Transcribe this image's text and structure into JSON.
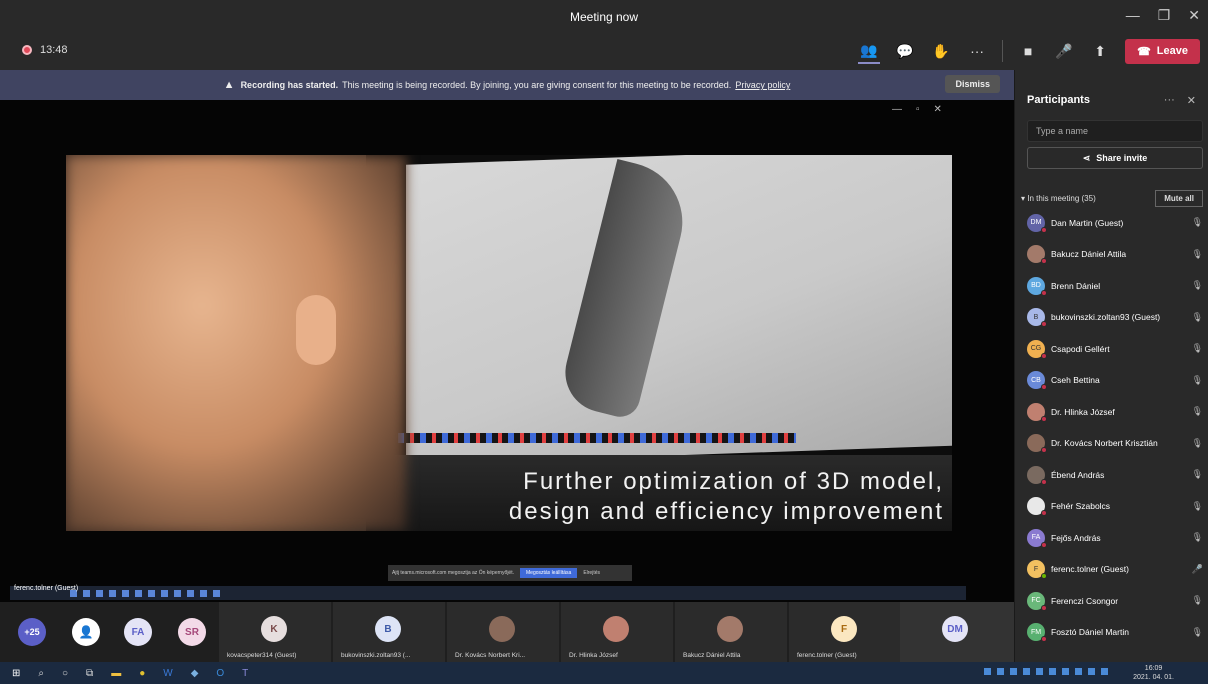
{
  "window": {
    "title": "Meeting now"
  },
  "meeting": {
    "timer": "13:48",
    "leave_label": "Leave",
    "tools": [
      "people-icon",
      "chat-icon",
      "reactions-icon",
      "more-icon",
      "camera-off-icon",
      "mic-off-icon",
      "share-icon"
    ]
  },
  "banner": {
    "bold": "Recording has started.",
    "text": "This meeting is being recorded. By joining, you are giving consent for this meeting to be recorded.",
    "link": "Privacy policy",
    "dismiss": "Dismiss"
  },
  "stage": {
    "caption_line1": "Further optimization of 3D model,",
    "caption_line2": "design and efficiency improvement",
    "presenter": "ferenc.tolner (Guest)",
    "notice_text": "Ajtj teams.microsoft.com megosztja az Ön képernyőjét.",
    "notice_btn": "Megosztás leállítása",
    "notice_hide": "Elrejtés"
  },
  "participants": {
    "title": "Participants",
    "search_placeholder": "Type a name",
    "share_invite": "Share invite",
    "in_meeting": "In this meeting (35)",
    "mute_all": "Mute all",
    "list": [
      {
        "initials": "DM",
        "name": "Dan Martin (Guest)",
        "color": "#6264a7"
      },
      {
        "initials": "",
        "name": "Bakucz Dániel Attila",
        "color": "#a37a6a"
      },
      {
        "initials": "BD",
        "name": "Brenn Dániel",
        "color": "#5ea8e0"
      },
      {
        "initials": "B",
        "name": "bukovinszki.zoltan93 (Guest)",
        "color": "#a8b8e8"
      },
      {
        "initials": "CG",
        "name": "Csapodi Gellért",
        "color": "#f0b050"
      },
      {
        "initials": "CB",
        "name": "Cseh Bettina",
        "color": "#6a8ad8"
      },
      {
        "initials": "",
        "name": "Dr. Hlinka József",
        "color": "#c08070"
      },
      {
        "initials": "",
        "name": "Dr. Kovács Norbert Krisztián",
        "color": "#8a6a5a"
      },
      {
        "initials": "",
        "name": "Ébend András",
        "color": "#7a6a60"
      },
      {
        "initials": "",
        "name": "Fehér Szabolcs",
        "color": "#e8e8e8"
      },
      {
        "initials": "FA",
        "name": "Fejős András",
        "color": "#8a7ad0"
      },
      {
        "initials": "F",
        "name": "ferenc.tolner (Guest)",
        "color": "#f2c060"
      },
      {
        "initials": "FC",
        "name": "Ferenczi Csongor",
        "color": "#6ab87a"
      },
      {
        "initials": "FM",
        "name": "Fosztó Dániel Martin",
        "color": "#58b070"
      }
    ]
  },
  "gallery": {
    "more": "+25",
    "rounds": [
      {
        "initials": "FA",
        "color": "#8a8ad8"
      },
      {
        "initials": "SR",
        "color": "#c88ab0"
      }
    ],
    "tiles": [
      {
        "initials": "K",
        "name": "kovacspeter314 (Guest)",
        "color": "#d8d0d0"
      },
      {
        "initials": "B",
        "name": "bukovinszki.zoltan93 (...",
        "color": "#a8b8e8"
      },
      {
        "initials": "",
        "name": "Dr. Kovács Norbert Kri...",
        "color": "#8a6a5a"
      },
      {
        "initials": "",
        "name": "Dr. Hlinka József",
        "color": "#c08070"
      },
      {
        "initials": "",
        "name": "Bakucz Dániel Attila",
        "color": "#a37a6a"
      },
      {
        "initials": "F",
        "name": "ferenc.tolner (Guest)",
        "color": "#f2c060"
      },
      {
        "initials": "DM",
        "name": "",
        "color": "#b8b8e0"
      }
    ]
  },
  "taskbar": {
    "time": "16:09",
    "date": "2021. 04. 01."
  }
}
